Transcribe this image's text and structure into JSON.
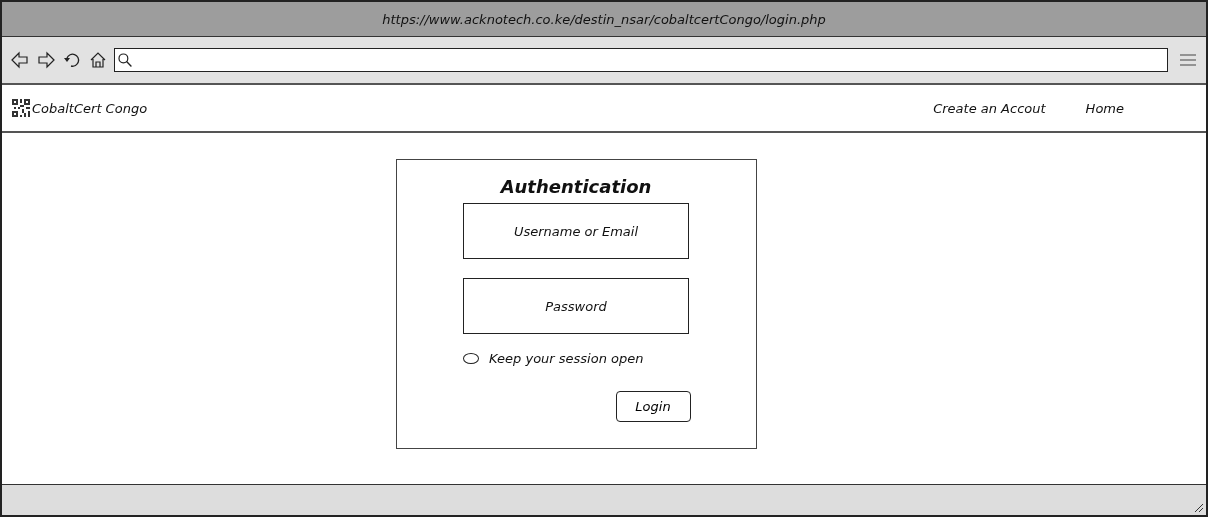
{
  "window": {
    "title": "https://www.acknotech.co.ke/destin_nsar/cobaltcertCongo/login.php"
  },
  "site": {
    "name": "CobaltCert Congo"
  },
  "nav": [
    {
      "label": "Create an Accout"
    },
    {
      "label": "Home"
    }
  ],
  "login": {
    "title": "Authentication",
    "username": {
      "placeholder": "Username or Email"
    },
    "password": {
      "placeholder": "Password"
    },
    "remember": {
      "label": "Keep your session open",
      "checked": false
    },
    "button": "Login"
  }
}
